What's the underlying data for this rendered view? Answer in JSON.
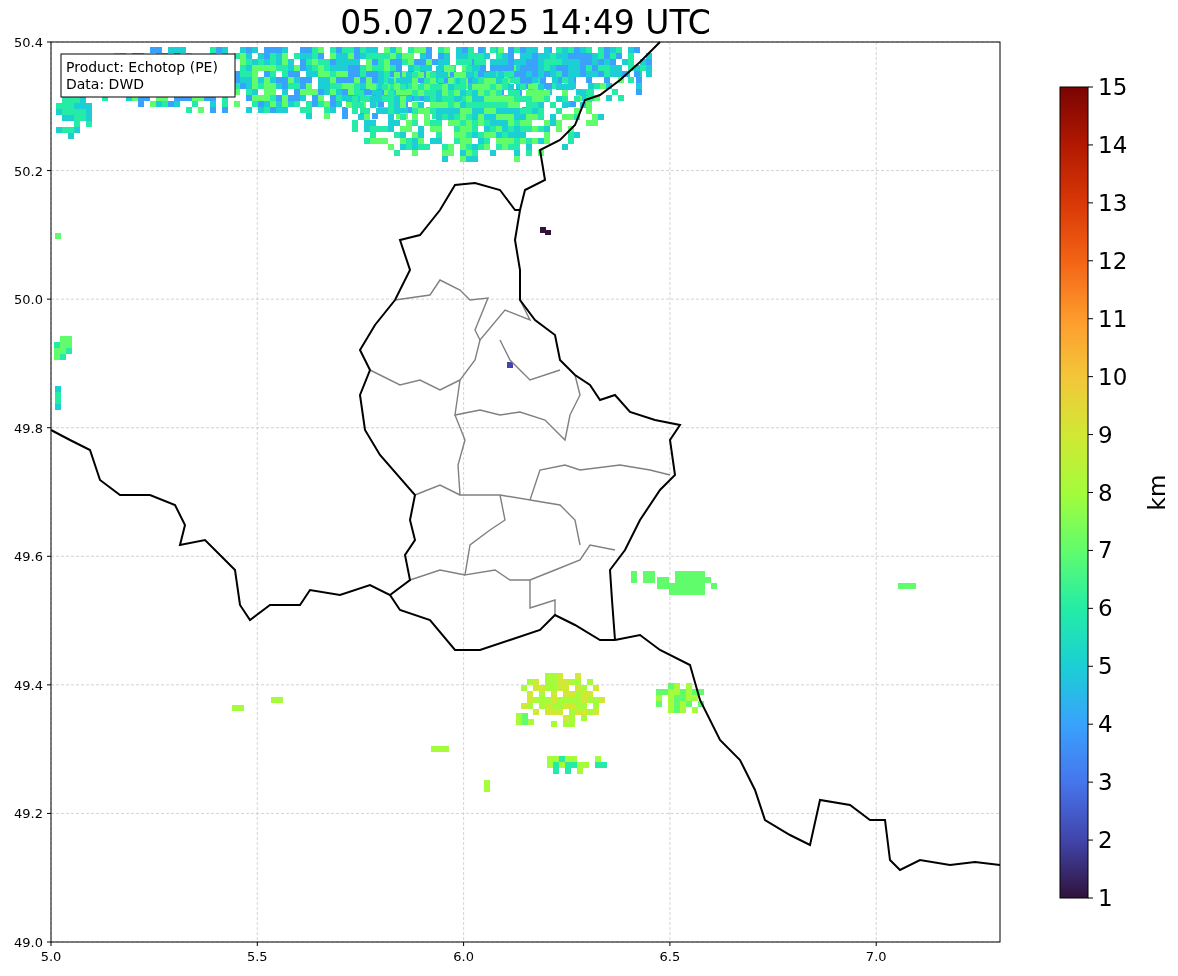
{
  "title": "05.07.2025 14:49 UTC",
  "legend": [
    "Product: Echotop (PE)",
    "Data: DWD"
  ],
  "x_ticks": [
    "5.0",
    "5.5",
    "6.0",
    "6.5",
    "7.0"
  ],
  "y_ticks": [
    "50.4",
    "50.2",
    "50.0",
    "49.8",
    "49.6",
    "49.4",
    "49.2",
    "49.0"
  ],
  "colorbar": {
    "label": "km",
    "ticks": [
      "15",
      "14",
      "13",
      "12",
      "11",
      "10",
      "9",
      "8",
      "7",
      "6",
      "5",
      "4",
      "3",
      "2",
      "1"
    ]
  }
}
